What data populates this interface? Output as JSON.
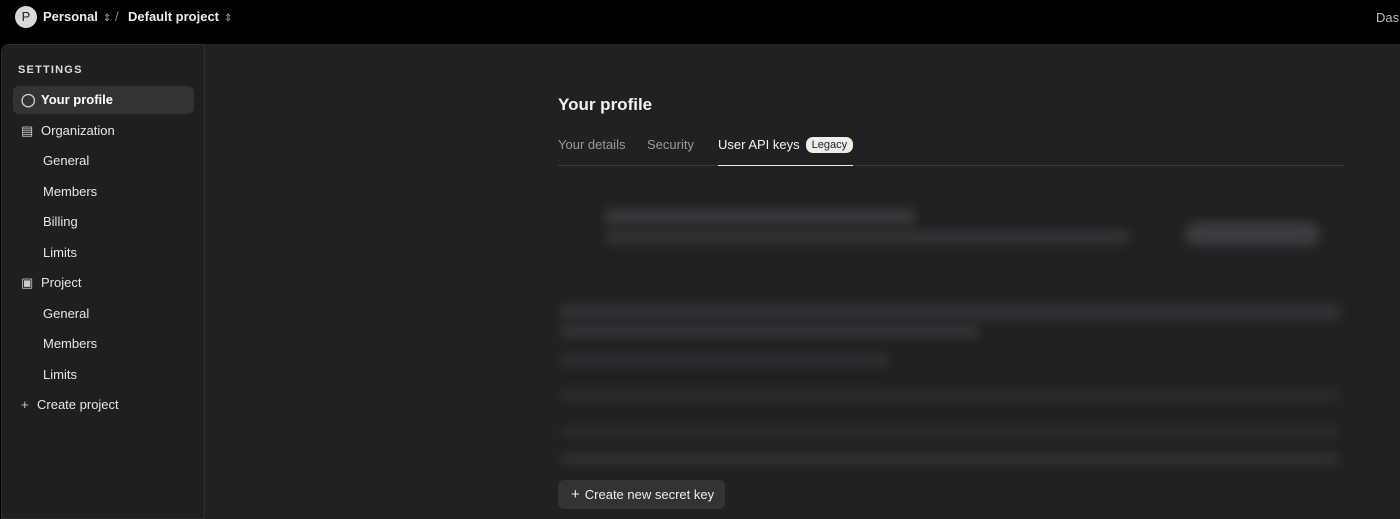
{
  "topbar": {
    "avatar_initial": "P",
    "org": "Personal",
    "project": "Default project",
    "separator": "/",
    "right_link": "Dash"
  },
  "sidebar": {
    "section_title": "SETTINGS",
    "items": [
      {
        "label": "Your profile",
        "icon": "user-icon",
        "active": true
      },
      {
        "label": "Organization",
        "icon": "building-icon"
      },
      {
        "label": "General",
        "sub": true
      },
      {
        "label": "Members",
        "sub": true
      },
      {
        "label": "Billing",
        "sub": true
      },
      {
        "label": "Limits",
        "sub": true
      },
      {
        "label": "Project",
        "icon": "briefcase-icon"
      },
      {
        "label": "General",
        "sub": true
      },
      {
        "label": "Members",
        "sub": true
      },
      {
        "label": "Limits",
        "sub": true
      },
      {
        "label": "Create project",
        "icon": "plus-icon"
      }
    ]
  },
  "main": {
    "title": "Your profile",
    "tabs": [
      {
        "label": "Your details"
      },
      {
        "label": "Security"
      },
      {
        "label": "User API keys",
        "active": true,
        "badge": "Legacy"
      }
    ],
    "create_button": "Create new secret key"
  }
}
